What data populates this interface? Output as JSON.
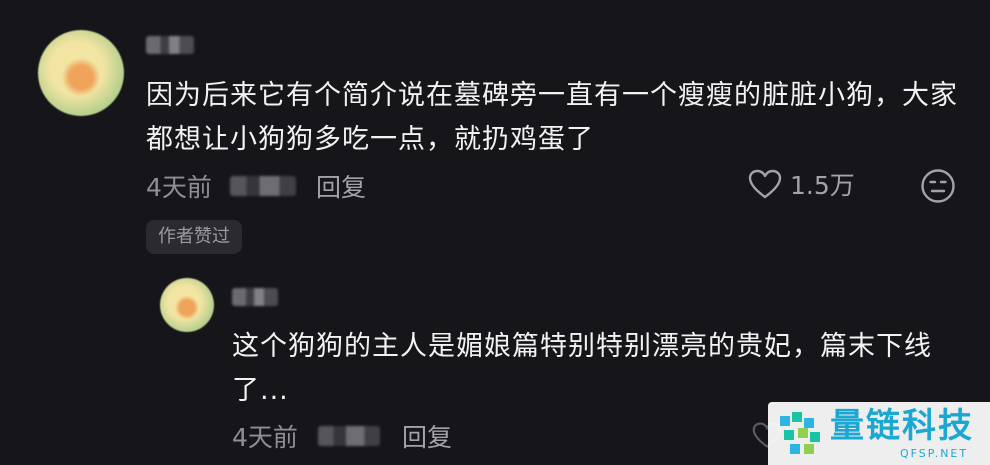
{
  "comment": {
    "text": "因为后来它有个简介说在墓碑旁一直有一个瘦瘦的脏脏小狗，大家都想让小狗狗多吃一点，就扔鸡蛋了",
    "time": "4天前",
    "reply_label": "回复",
    "like_count": "1.5万",
    "author_liked_badge": "作者赞过"
  },
  "reply": {
    "text": "这个狗狗的主人是媚娘篇特别特别漂亮的贵妃，篇末下线了...",
    "time": "4天前",
    "reply_label": "回复"
  },
  "watermark": {
    "brand": "量链科技",
    "domain": "QFSP.NET"
  },
  "colors": {
    "background": "#16161a",
    "text_primary": "#f2f2f2",
    "text_secondary": "#8e8e94",
    "watermark_accent": "#1aa8d2"
  }
}
